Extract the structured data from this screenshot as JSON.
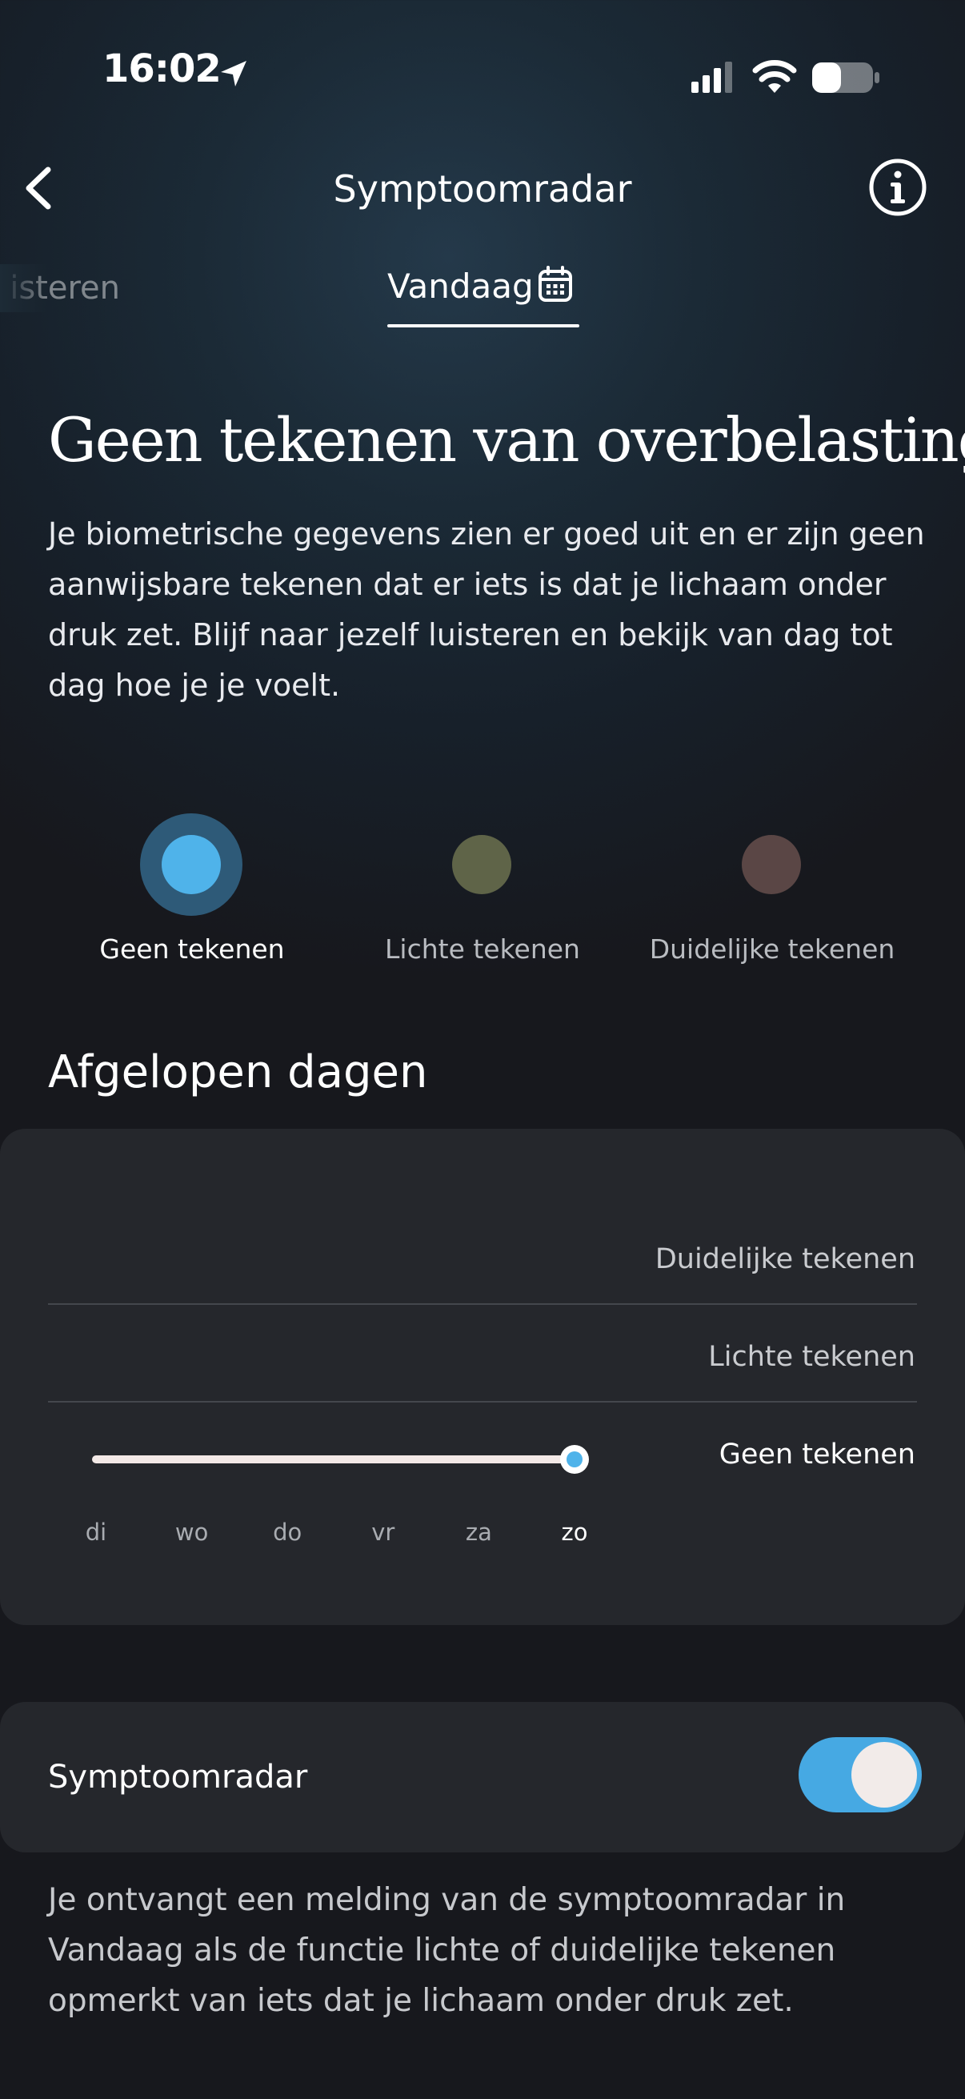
{
  "status_bar": {
    "time": "16:02",
    "icons": [
      "location-arrow-icon",
      "cellular-signal-icon",
      "wifi-icon",
      "battery-icon"
    ]
  },
  "header": {
    "title": "Symptoomradar",
    "back_icon": "chevron-left-icon",
    "info_icon": "info-icon"
  },
  "tabs": {
    "previous_label": "isteren",
    "current_label": "Vandaag",
    "current_icon": "calendar-icon"
  },
  "status": {
    "headline": "Geen tekenen van overbelasting",
    "description": "Je biometrische gegevens zien er goed uit en er zijn geen aanwijsbare tekenen dat er iets is dat je lichaam onder druk zet. Blijf naar jezelf luisteren en bekijk van dag tot dag hoe je je voelt."
  },
  "legend": [
    {
      "label": "Geen tekenen",
      "color": "#4fb3ea",
      "active": true
    },
    {
      "label": "Lichte tekenen",
      "color": "#5f6448",
      "active": false
    },
    {
      "label": "Duidelijke tekenen",
      "color": "#5a4645",
      "active": false
    }
  ],
  "history": {
    "title": "Afgelopen dagen"
  },
  "chart_data": {
    "type": "line",
    "title": "",
    "categories": [
      "di",
      "wo",
      "do",
      "vr",
      "za",
      "zo"
    ],
    "y_levels": [
      "Geen tekenen",
      "Lichte tekenen",
      "Duidelijke tekenen"
    ],
    "series": [
      {
        "values": [
          "Geen tekenen",
          "Geen tekenen",
          "Geen tekenen",
          "Geen tekenen",
          "Geen tekenen",
          "Geen tekenen"
        ]
      }
    ],
    "highlighted_category": "zo",
    "line_color": "#f3e9e7",
    "marker_color": "#4fb3ea"
  },
  "settings": {
    "toggle_label": "Symptoomradar",
    "toggle_on": true,
    "toggle_color": "#46a9e3",
    "note": "Je ontvangt een melding van de symptoomradar in Vandaag als de functie lichte of duidelijke tekenen opmerkt van iets dat je lichaam onder druk zet."
  }
}
